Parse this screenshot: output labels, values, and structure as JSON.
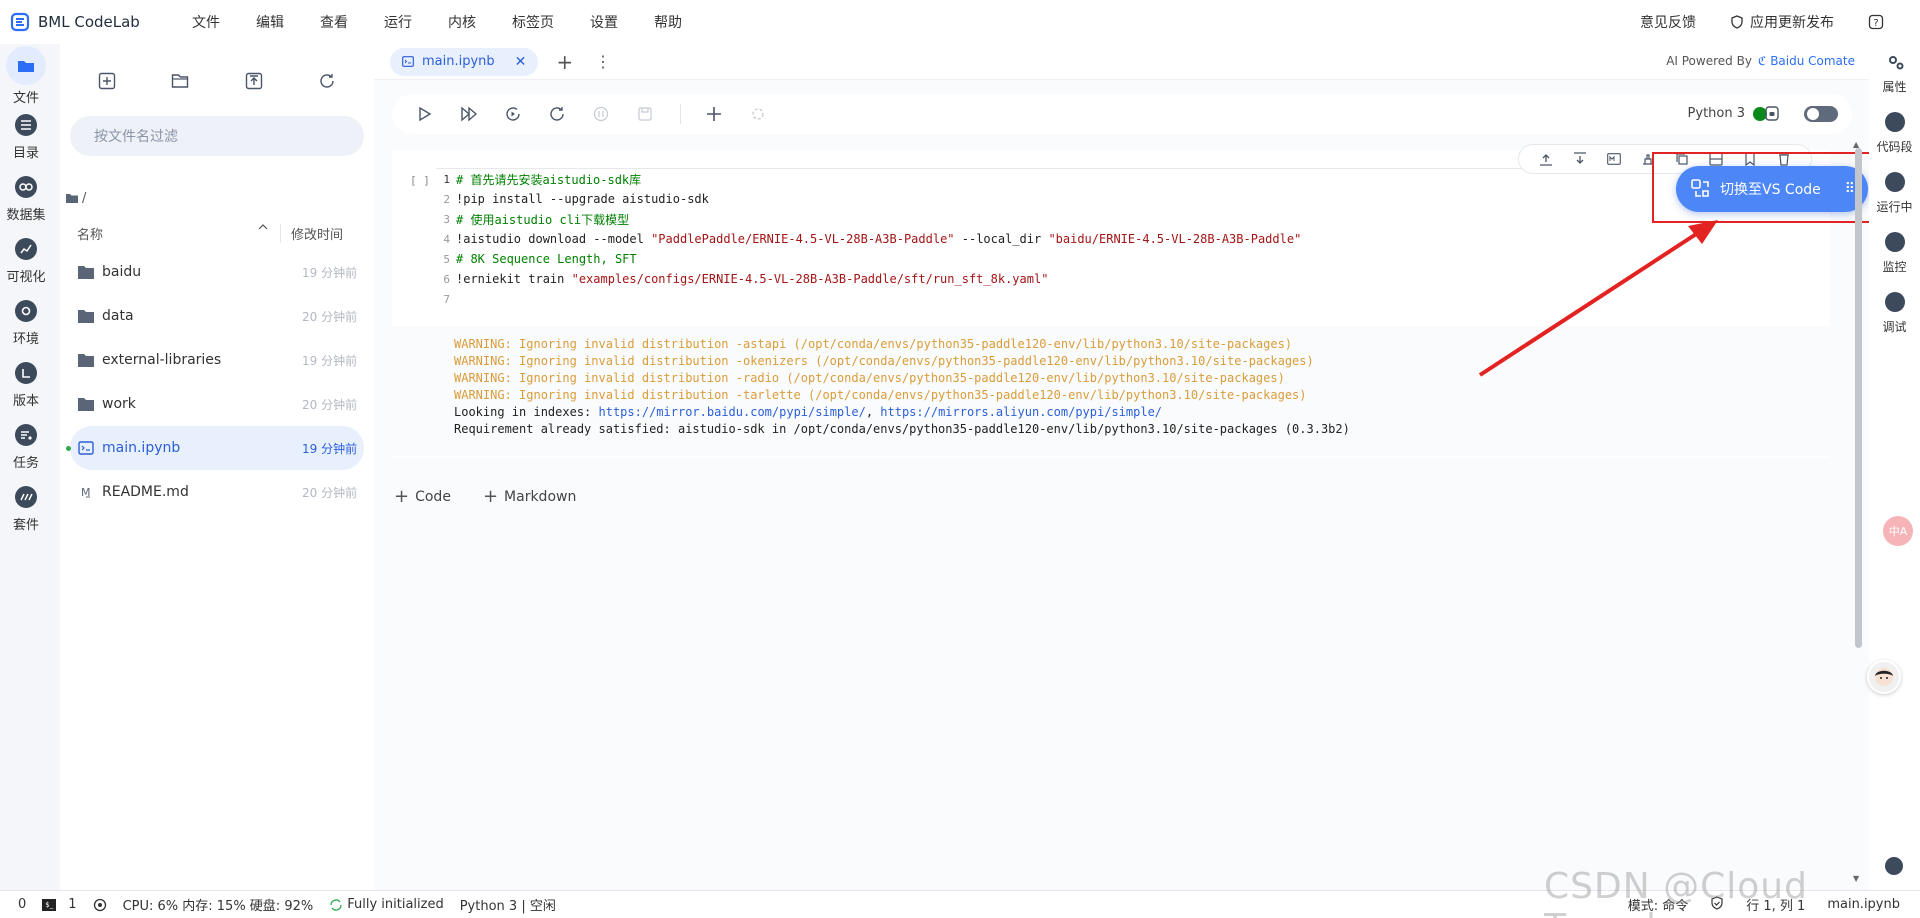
{
  "brand": {
    "name": "BML CodeLab"
  },
  "menu": [
    "文件",
    "编辑",
    "查看",
    "运行",
    "内核",
    "标签页",
    "设置",
    "帮助"
  ],
  "top_right": {
    "feedback": "意见反馈",
    "release": "应用更新发布"
  },
  "activity": [
    {
      "label": "文件",
      "icon": "folder-icon"
    },
    {
      "label": "目录",
      "icon": "toc-icon"
    },
    {
      "label": "数据集",
      "icon": "dataset-icon"
    },
    {
      "label": "可视化",
      "icon": "chart-icon"
    },
    {
      "label": "环境",
      "icon": "environment-icon"
    },
    {
      "label": "版本",
      "icon": "version-icon"
    },
    {
      "label": "任务",
      "icon": "task-icon"
    },
    {
      "label": "套件",
      "icon": "suite-icon"
    }
  ],
  "file_panel": {
    "search_placeholder": "按文件名过滤",
    "path": "/",
    "col_name": "名称",
    "col_time": "修改时间",
    "files": [
      {
        "name": "baidu",
        "time": "19 分钟前",
        "type": "folder"
      },
      {
        "name": "data",
        "time": "20 分钟前",
        "type": "folder"
      },
      {
        "name": "external-libraries",
        "time": "19 分钟前",
        "type": "folder"
      },
      {
        "name": "work",
        "time": "20 分钟前",
        "type": "folder"
      },
      {
        "name": "main.ipynb",
        "time": "19 分钟前",
        "type": "notebook"
      },
      {
        "name": "README.md",
        "time": "20 分钟前",
        "type": "markdown"
      }
    ]
  },
  "tabs": [
    {
      "label": "main.ipynb"
    }
  ],
  "ai_powered": {
    "prefix": "AI Powered By",
    "name": "Baidu Comate"
  },
  "toolbar": {
    "kernel": "Python 3"
  },
  "cell": {
    "prompt": "[ ]",
    "lines": [
      {
        "n": "1",
        "parts": [
          {
            "t": "# 首先请先安装aistudio-sdk库",
            "c": "c-comment"
          }
        ]
      },
      {
        "n": "2",
        "parts": [
          {
            "t": "!pip install --upgrade aistudio-sdk",
            "c": "c-plain"
          }
        ]
      },
      {
        "n": "3",
        "parts": [
          {
            "t": "# 使用aistudio cli下载模型",
            "c": "c-comment"
          }
        ]
      },
      {
        "n": "4",
        "parts": [
          {
            "t": "!aistudio download --model ",
            "c": "c-plain"
          },
          {
            "t": "\"PaddlePaddle/ERNIE-4.5-VL-28B-A3B-Paddle\"",
            "c": "c-str"
          },
          {
            "t": " --local_dir ",
            "c": "c-plain"
          },
          {
            "t": "\"baidu/ERNIE-4.5-VL-28B-A3B-Paddle\"",
            "c": "c-str"
          }
        ]
      },
      {
        "n": "5",
        "parts": [
          {
            "t": "# 8K Sequence Length, SFT",
            "c": "c-comment"
          }
        ]
      },
      {
        "n": "6",
        "parts": [
          {
            "t": "!erniekit train ",
            "c": "c-plain"
          },
          {
            "t": "\"examples/configs/ERNIE-4.5-VL-28B-A3B-Paddle/sft/run_sft_8k.yaml\"",
            "c": "c-str"
          }
        ]
      },
      {
        "n": "7",
        "parts": []
      }
    ],
    "output": [
      {
        "parts": [
          {
            "t": "WARNING: Ignoring invalid distribution -astapi (/opt/conda/envs/python35-paddle120-env/lib/python3.10/site-packages)",
            "c": "out-warn"
          }
        ]
      },
      {
        "parts": [
          {
            "t": "WARNING: Ignoring invalid distribution -okenizers (/opt/conda/envs/python35-paddle120-env/lib/python3.10/site-packages)",
            "c": "out-warn"
          }
        ]
      },
      {
        "parts": [
          {
            "t": "WARNING: Ignoring invalid distribution -radio (/opt/conda/envs/python35-paddle120-env/lib/python3.10/site-packages)",
            "c": "out-warn"
          }
        ]
      },
      {
        "parts": [
          {
            "t": "WARNING: Ignoring invalid distribution -tarlette (/opt/conda/envs/python35-paddle120-env/lib/python3.10/site-packages)",
            "c": "out-warn"
          }
        ]
      },
      {
        "parts": [
          {
            "t": "Looking in indexes: ",
            "c": "out-plain"
          },
          {
            "t": "https://mirror.baidu.com/pypi/simple/",
            "c": "out-link"
          },
          {
            "t": ", ",
            "c": "out-plain"
          },
          {
            "t": "https://mirrors.aliyun.com/pypi/simple/",
            "c": "out-link"
          }
        ]
      },
      {
        "parts": [
          {
            "t": "Requirement already satisfied: aistudio-sdk in /opt/conda/envs/python35-paddle120-env/lib/python3.10/site-packages (0.3.3b2)",
            "c": "out-plain"
          }
        ]
      }
    ]
  },
  "add_cell": {
    "code": "Code",
    "markdown": "Markdown"
  },
  "vs_switch": {
    "label": "切换至VS Code"
  },
  "rightbar": [
    {
      "label": "属性",
      "icon": "gear-icon"
    },
    {
      "label": "代码段",
      "icon": "snippet-icon"
    },
    {
      "label": "运行中",
      "icon": "running-icon"
    },
    {
      "label": "监控",
      "icon": "monitor-icon"
    },
    {
      "label": "调试",
      "icon": "debug-icon"
    }
  ],
  "translate_fab": "中A",
  "status": {
    "count0": "0",
    "count1": "1",
    "resources": "CPU:  6% 内存:  15% 硬盘:  92%",
    "init": "Fully initialized",
    "kernel": "Python 3 | 空闲",
    "mode": "模式:  命令",
    "position": "行 1,  列 1",
    "file": "main.ipynb"
  },
  "watermark": "CSDN @Cloud Traveler",
  "colors": {
    "accent": "#2b5fd9",
    "switch": "#4d87f7",
    "highlight": "#e32222",
    "kernel_ok": "#0a8a1a"
  }
}
